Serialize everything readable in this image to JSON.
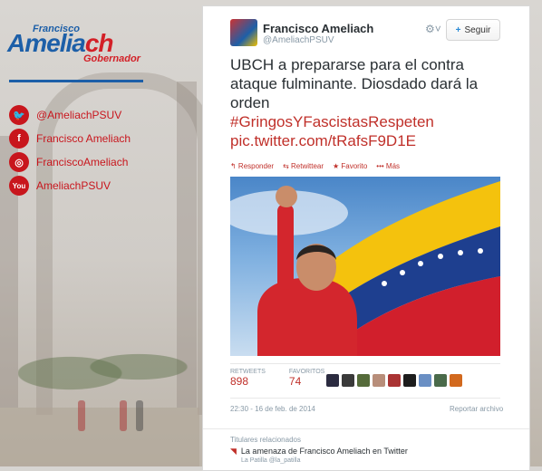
{
  "sidebar": {
    "logo": {
      "first_name": "Francisco",
      "last_name_a": "Amelia",
      "last_name_b": "ch",
      "role": "Gobernador"
    },
    "social": [
      {
        "icon": "twitter-bird-icon",
        "glyph": "🐦",
        "label": "@AmeliachPSUV"
      },
      {
        "icon": "facebook-icon",
        "glyph": "f",
        "label": "Francisco Ameliach"
      },
      {
        "icon": "instagram-icon",
        "glyph": "◎",
        "label": "FranciscoAmeliach"
      },
      {
        "icon": "youtube-icon",
        "glyph": "You",
        "label": "AmeliachPSUV"
      }
    ]
  },
  "tweet": {
    "author_name": "Francisco Ameliach",
    "author_handle": "@AmeliachPSUV",
    "follow_label": "Seguir",
    "gear_glyph": "⚙˅",
    "text": "UBCH a prepararse para el contra ataque fulminante. Diosdado dará la orden",
    "hashtag": "#GringosYFascistasRespeten",
    "link": "pic.twitter.com/tRafsF9D1E",
    "actions": {
      "reply": "↰ Responder",
      "retweet": "⇆ Retwittear",
      "favorite": "★ Favorito",
      "more": "••• Más"
    },
    "stats": {
      "retweets_label": "RETWEETS",
      "retweets_value": "898",
      "favorites_label": "FAVORITOS",
      "favorites_value": "74"
    },
    "datetime": "22:30 - 16 de feb. de 2014",
    "report": "Reportar archivo",
    "related": {
      "heading": "Titulares relacionados",
      "title": "La amenaza de Francisco Ameliach en Twitter",
      "source": "La Patilla @la_patilla"
    }
  },
  "colors": {
    "brand_blue": "#1d5fa8",
    "brand_red": "#d32027",
    "link_red": "#c0302a",
    "flag_yellow": "#f4c20d",
    "flag_blue": "#1e3f8f",
    "flag_red": "#d11f2c"
  }
}
